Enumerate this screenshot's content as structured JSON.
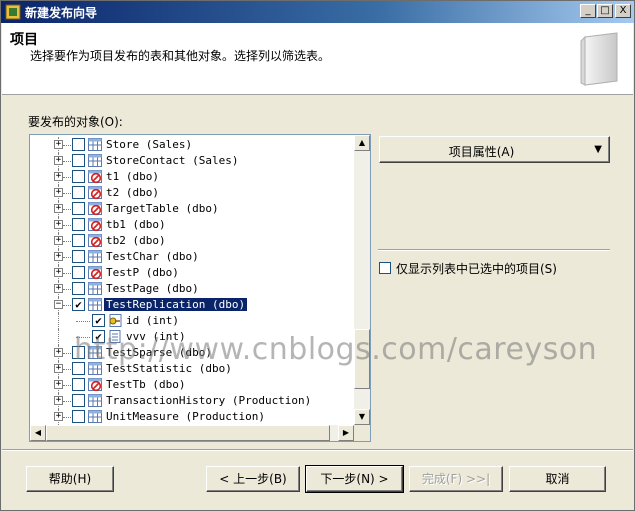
{
  "window": {
    "title": "新建发布向导",
    "buttons": {
      "minimize": "_",
      "maximize": "□",
      "close": "X"
    }
  },
  "header": {
    "title": "项目",
    "description": "选择要作为项目发布的表和其他对象。选择列以筛选表。"
  },
  "objects": {
    "label": "要发布的对象(O):",
    "items": [
      {
        "label": "Store (Sales)",
        "icon": "table-icon",
        "checked": false,
        "expander": "+"
      },
      {
        "label": "StoreContact (Sales)",
        "icon": "table-icon",
        "checked": false,
        "expander": "+"
      },
      {
        "label": "t1 (dbo)",
        "icon": "table-blocked-icon",
        "checked": false,
        "expander": "+"
      },
      {
        "label": "t2 (dbo)",
        "icon": "table-blocked-icon",
        "checked": false,
        "expander": "+"
      },
      {
        "label": "TargetTable (dbo)",
        "icon": "table-blocked-icon",
        "checked": false,
        "expander": "+"
      },
      {
        "label": "tb1 (dbo)",
        "icon": "table-blocked-icon",
        "checked": false,
        "expander": "+"
      },
      {
        "label": "tb2 (dbo)",
        "icon": "table-blocked-icon",
        "checked": false,
        "expander": "+"
      },
      {
        "label": "TestChar (dbo)",
        "icon": "table-icon",
        "checked": false,
        "expander": "+"
      },
      {
        "label": "TestP (dbo)",
        "icon": "table-blocked-icon",
        "checked": false,
        "expander": "+"
      },
      {
        "label": "TestPage (dbo)",
        "icon": "table-icon",
        "checked": false,
        "expander": "+"
      },
      {
        "label": "TestReplication (dbo)",
        "icon": "table-icon",
        "checked": true,
        "expander": "−",
        "selected": true
      },
      {
        "label": "id (int)",
        "icon": "key-column-icon",
        "checked": true,
        "child": true
      },
      {
        "label": "vvv (int)",
        "icon": "column-icon",
        "checked": true,
        "child": true
      },
      {
        "label": "TestSparse (dbo)",
        "icon": "table-icon",
        "checked": false,
        "expander": "+"
      },
      {
        "label": "TestStatistic (dbo)",
        "icon": "table-icon",
        "checked": false,
        "expander": "+"
      },
      {
        "label": "TestTb (dbo)",
        "icon": "table-blocked-icon",
        "checked": false,
        "expander": "+"
      },
      {
        "label": "TransactionHistory (Production)",
        "icon": "table-icon",
        "checked": false,
        "expander": "+"
      },
      {
        "label": "UnitMeasure (Production)",
        "icon": "table-icon",
        "checked": false,
        "expander": "+"
      }
    ]
  },
  "properties_button": {
    "label": "项目属性(A)",
    "arrow": "▼"
  },
  "only_selected": {
    "label": "仅显示列表中已选中的项目(S)",
    "checked": false
  },
  "watermark": "http://www.cnblogs.com/careyson",
  "footer": {
    "help": "帮助(H)",
    "back": "< 上一步(B)",
    "next": "下一步(N) >",
    "finish": "完成(F) >>|",
    "cancel": "取消"
  }
}
